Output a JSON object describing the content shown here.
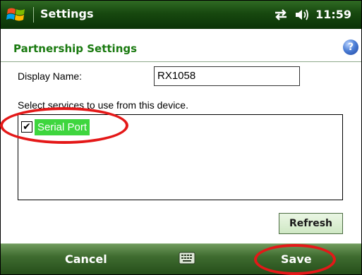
{
  "titlebar": {
    "app_title": "Settings",
    "clock": "11:59",
    "icons": [
      "windows-start-icon",
      "connectivity-icon",
      "volume-icon"
    ]
  },
  "page": {
    "title": "Partnership Settings",
    "help_icon": "?"
  },
  "form": {
    "display_name_label": "Display Name:",
    "display_name_value": "RX1058",
    "services_label": "Select services to use from this device.",
    "services": [
      {
        "label": "Serial Port",
        "checked": true,
        "selected": true
      }
    ],
    "refresh_label": "Refresh"
  },
  "softkeys": {
    "left": "Cancel",
    "right": "Save",
    "center_icon": "keyboard-icon"
  },
  "colors": {
    "titlebar": "#1f5a17",
    "page_title": "#1a7a10",
    "selection": "#3ed63e",
    "annotation": "#e41818"
  }
}
